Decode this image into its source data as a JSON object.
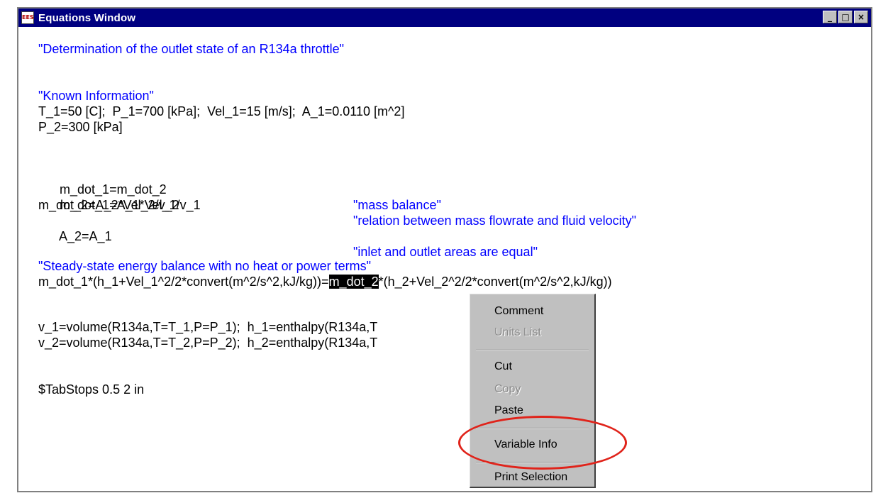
{
  "window": {
    "title": "Equations Window",
    "icon_text": "EES",
    "controls": {
      "minimize": "_",
      "maximize": "□",
      "close": "×"
    }
  },
  "equations": {
    "header_comment": "\"Determination of the outlet state of an R134a throttle\"",
    "known_comment": "\"Known Information\"",
    "known_line1": "T_1=50 [C];  P_1=700 [kPa];  Vel_1=15 [m/s];  A_1=0.0110 [m^2]",
    "known_line2": "P_2=300 [kPa]",
    "mass1_eq": "m_dot_1=m_dot_2",
    "mass1_comment": "\"mass balance\"",
    "mass2_eq": "m_dot_1=A_1*Vel_1/v_1",
    "mass2_comment": "\"relation between mass flowrate and fluid velocity\"",
    "mass3_eq": "m_dot_2=A_2*Vel_2/v_2",
    "area_eq": "A_2=A_1",
    "area_comment": "\"inlet and outlet areas are equal\"",
    "energy_comment": "\"Steady-state energy balance with no heat or power terms\"",
    "energy_pre": "m_dot_1*(h_1+Vel_1^2/2*convert(m^2/s^2,kJ/kg))=",
    "energy_selected": "m_dot_2",
    "energy_hidden": "*(h_2+Vel_2^2/2*c",
    "energy_post": "onvert(m^2/s^2,kJ/kg))",
    "props_line1": "v_1=volume(R134a,T=T_1,P=P_1);  h_1=enthalpy(R134a,T",
    "props_line2": "v_2=volume(R134a,T=T_2,P=P_2);  h_2=enthalpy(R134a,T",
    "tabstops": "$TabStops 0.5 2 in"
  },
  "context_menu": {
    "comment": "Comment",
    "units_list": "Units List",
    "cut": "Cut",
    "copy": "Copy",
    "paste": "Paste",
    "variable_info": "Variable Info",
    "print_selection": "Print Selection"
  },
  "colors": {
    "title_bar": "#000080",
    "comment_text": "#0000ff",
    "highlight_ring": "#e0231a",
    "menu_background": "#c0c0c0"
  }
}
